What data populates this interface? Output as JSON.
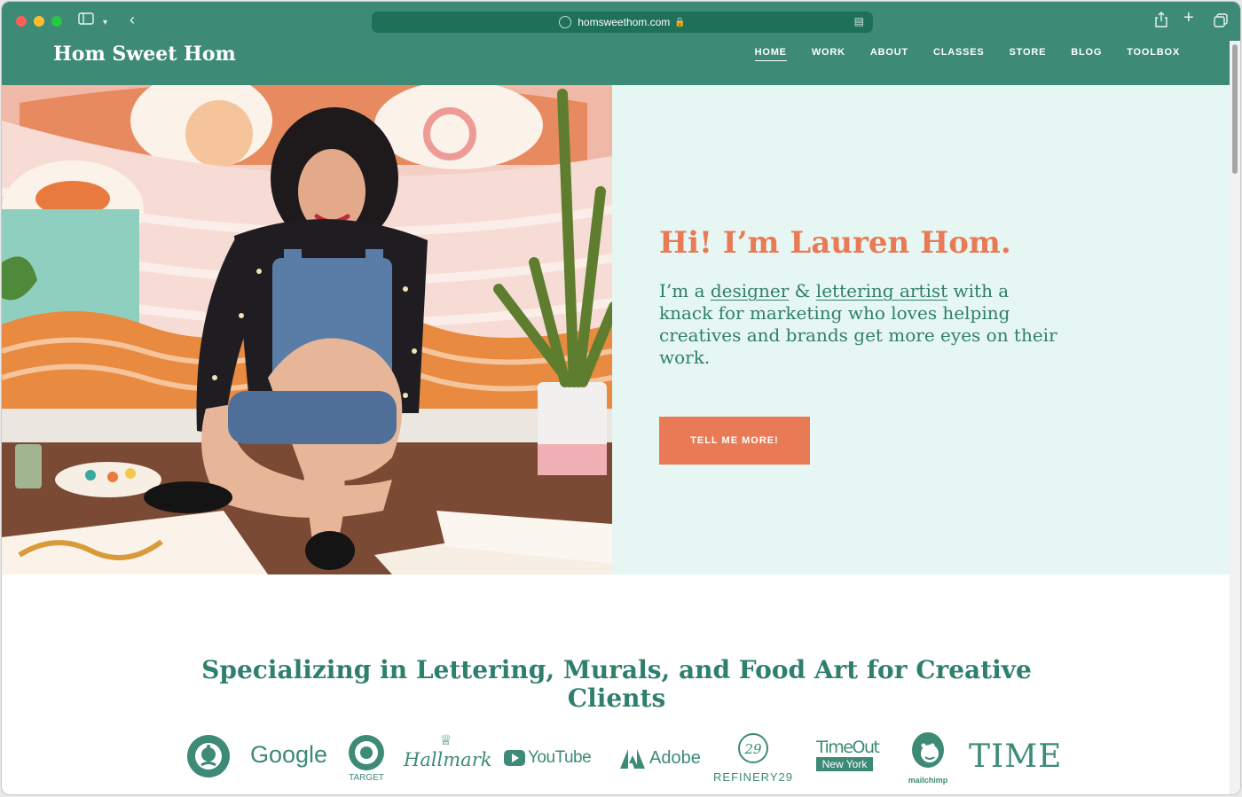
{
  "browser": {
    "url": "homsweethom.com"
  },
  "site": {
    "logo": "Hom Sweet Hom",
    "nav": [
      "HOME",
      "WORK",
      "ABOUT",
      "CLASSES",
      "STORE",
      "BLOG",
      "TOOLBOX"
    ],
    "active_nav": "HOME"
  },
  "hero": {
    "title": "Hi! I’m Lauren Hom.",
    "desc_parts": [
      "I’m a ",
      "designer",
      " & ",
      "lettering artist",
      " with a knack for marketing who loves helping creatives and brands get more eyes on their work."
    ],
    "cta": "TELL ME MORE!"
  },
  "clients": {
    "title": "Specializing in Lettering, Murals, and Food Art for Creative Clients",
    "logos": {
      "google": "Google",
      "target": "TARGET",
      "hallmark": "Hallmark",
      "youtube": "YouTube",
      "adobe": "Adobe",
      "refinery29": "REFINERY29",
      "timeout_line1": "TimeOut",
      "timeout_line2": "New York",
      "mailchimp": "mailchimp",
      "time": "TIME"
    }
  },
  "colors": {
    "header_teal": "#3d8a77",
    "accent_coral": "#e87a55",
    "hero_bg": "#e6f6f2",
    "text_teal": "#2f7f6d"
  }
}
